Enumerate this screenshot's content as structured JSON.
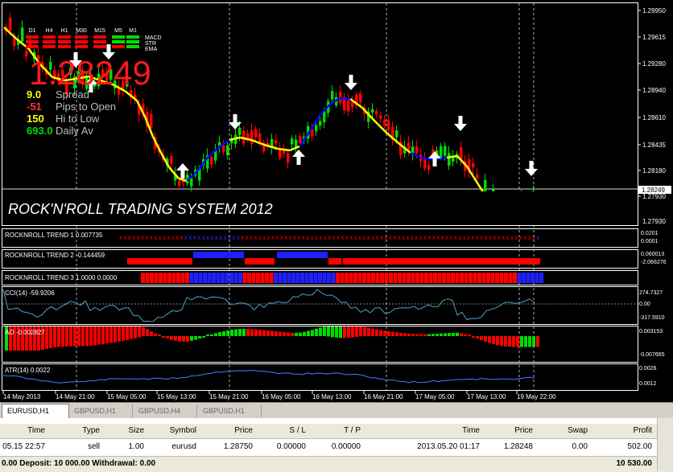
{
  "colors": {
    "bg": "#000000",
    "bull": "#00dd00",
    "bear": "#ff0000",
    "ma_up": "#0000ff",
    "ma_down": "#ffff00",
    "grid": "#ffffff",
    "indicator_line": "#4aa3c8"
  },
  "price_axis": [
    "1.29950",
    "1.29615",
    "1.29285",
    "1.28955",
    "1.28620",
    "1.28290",
    "1.27960",
    "1.27625"
  ],
  "price_axis_labels": [
    "1.29950",
    "1.29615",
    "1.29280",
    "1.28940",
    "1.28610",
    "1.28435",
    "1.28180",
    "1.27930"
  ],
  "current_price_tag": "1.28249",
  "timeframes": [
    "D1",
    "H4",
    "H1",
    "M30",
    "M15",
    "M5",
    "M1"
  ],
  "tf_labels": [
    "MACD",
    "STR",
    "EMA"
  ],
  "big_price": "1.28249",
  "stats": [
    {
      "value": "9.0",
      "label": "Spread",
      "color": "#ffff00"
    },
    {
      "value": "-51",
      "label": "Pips to Open",
      "color": "#ff3030"
    },
    {
      "value": "150",
      "label": "Hi to Low",
      "color": "#ffff00"
    },
    {
      "value": "693.0",
      "label": "Daily Av",
      "color": "#00dd00"
    }
  ],
  "system_title": "ROCK'N'ROLL TRADING SYSTEM 2012",
  "trend_rows": [
    {
      "label": "ROCKNROLL TREND 1 0.007735",
      "axis_top": "0.0201",
      "axis_bottom": "0.0001"
    },
    {
      "label": "ROCKNROLL TREND 2 -0.144459",
      "axis_top": "0.060013",
      "axis_bottom": "-2.066276"
    },
    {
      "label": "ROCKNROLL TREND 3 1.0000 0.0000",
      "axis_top": "",
      "axis_bottom": ""
    }
  ],
  "cci": {
    "label": "CCI(14) -59.9206",
    "axis": [
      "274.7327",
      "0.00",
      "-317.5910"
    ]
  },
  "ao": {
    "label": "AO -0.002827",
    "axis": [
      "0.003153",
      "-0.007665"
    ]
  },
  "atr": {
    "label": "ATR(14) 0.0022",
    "axis": [
      "0.0026",
      "0.0012"
    ]
  },
  "time_axis": [
    "14 May 2013",
    "14 May 21:00",
    "15 May 05:00",
    "15 May 13:00",
    "15 May 21:00",
    "16 May 05:00",
    "16 May 13:00",
    "16 May 21:00",
    "17 May 05:00",
    "17 May 13:00",
    "19 May 22:00"
  ],
  "tabs": [
    "EURUSD,H1",
    "GBPUSD,H1",
    "GBPUSD,H4",
    "GBPUSD,H1"
  ],
  "table": {
    "headers": [
      "Time",
      "Type",
      "Size",
      "Symbol",
      "Price",
      "S / L",
      "T / P",
      "Time",
      "Price",
      "Swap",
      "Profit"
    ],
    "row": [
      "05.15 22:57",
      "sell",
      "1.00",
      "eurusd",
      "1.28750",
      "0.00000",
      "0.00000",
      "2013.05.20 01:17",
      "1.28248",
      "0.00",
      "502.00"
    ],
    "footer_left": "0.00  Deposit: 10 000.00  Withdrawal: 0.00",
    "footer_right": "10 530.00"
  }
}
